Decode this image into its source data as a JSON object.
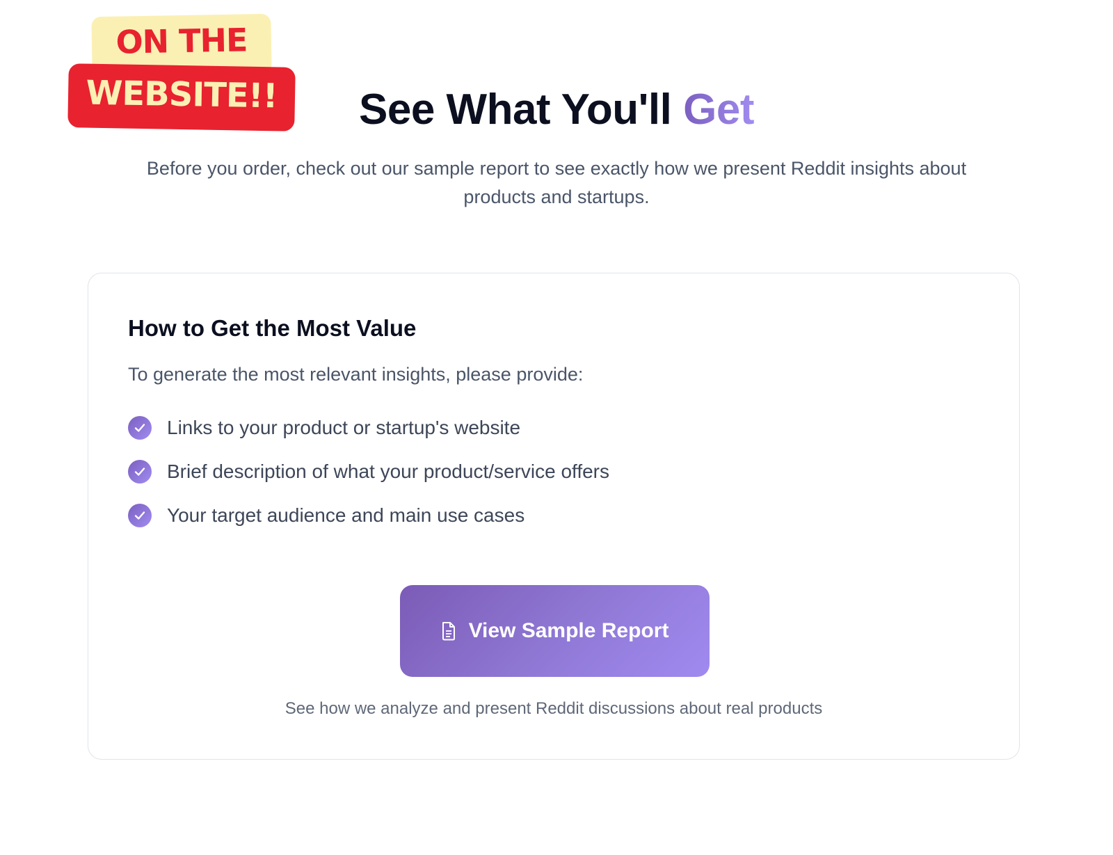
{
  "sticker": {
    "line1": "ON THE",
    "line2": "WEBSITE!!"
  },
  "header": {
    "title_main": "See What You'll",
    "title_accent": "Get",
    "subtitle": "Before you order, check out our sample report to see exactly how we present Reddit insights about products and startups."
  },
  "card": {
    "title": "How to Get the Most Value",
    "intro": "To generate the most relevant insights, please provide:",
    "items": [
      {
        "label": "Links to your product or startup's website",
        "icon": "check-circle-icon"
      },
      {
        "label": "Brief description of what your product/service offers",
        "icon": "check-circle-icon"
      },
      {
        "label": "Your target audience and main use cases",
        "icon": "check-circle-icon"
      }
    ],
    "button": {
      "label": "View Sample Report",
      "icon": "document-icon"
    },
    "note": "See how we analyze and present Reddit discussions about real products"
  },
  "colors": {
    "accent": "#8b6fd6",
    "sticker_red": "#e8222f",
    "sticker_yellow": "#fbf0b4"
  }
}
